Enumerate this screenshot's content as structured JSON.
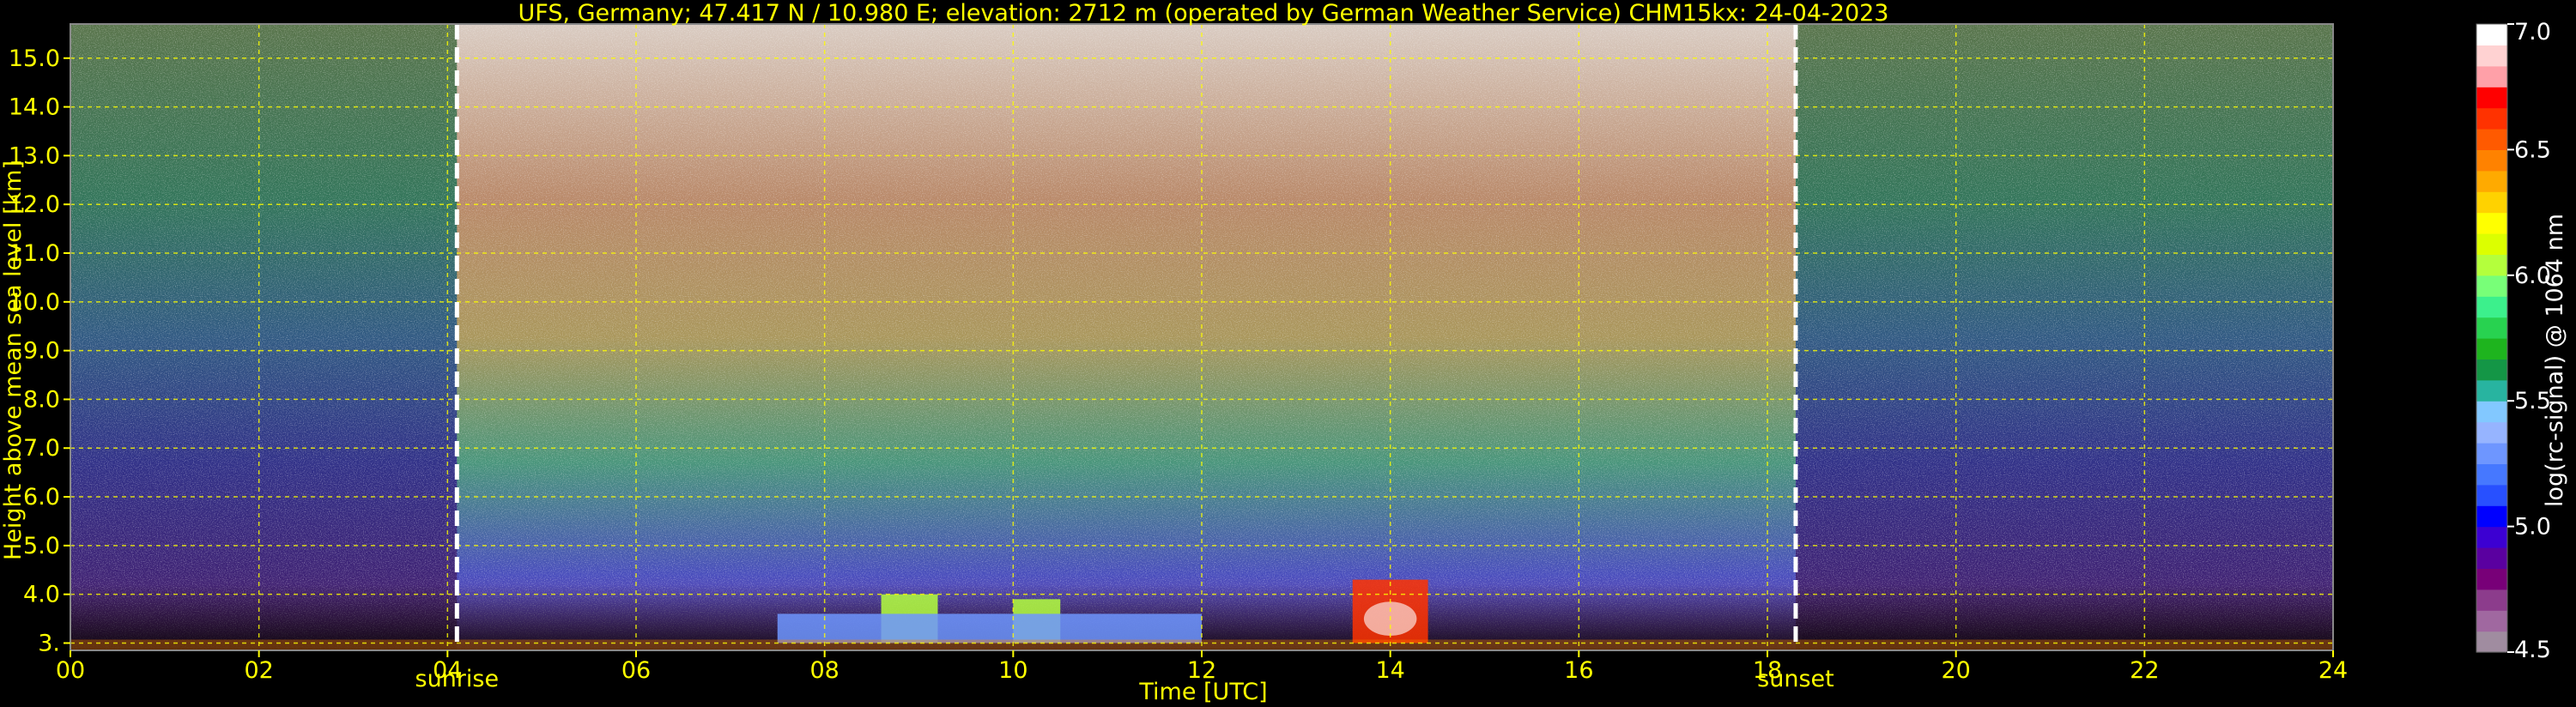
{
  "chart_data": {
    "type": "heatmap",
    "title": "UFS, Germany; 47.417 N / 10.980 E; elevation: 2712 m  (operated by German Weather Service)    CHM15kx: 24-04-2023",
    "xlabel": "Time [UTC]",
    "ylabel": "Height above mean sea level [km]",
    "colorbar_label": "log(rc-signal) @ 1064 nm",
    "xlim": [
      0,
      24
    ],
    "ylim": [
      2.85,
      15.7
    ],
    "x_ticks": [
      {
        "value": 0,
        "label": "00"
      },
      {
        "value": 2,
        "label": "02"
      },
      {
        "value": 4,
        "label": "04"
      },
      {
        "value": 6,
        "label": "06"
      },
      {
        "value": 8,
        "label": "08"
      },
      {
        "value": 10,
        "label": "10"
      },
      {
        "value": 12,
        "label": "12"
      },
      {
        "value": 14,
        "label": "14"
      },
      {
        "value": 16,
        "label": "16"
      },
      {
        "value": 18,
        "label": "18"
      },
      {
        "value": 20,
        "label": "20"
      },
      {
        "value": 22,
        "label": "22"
      },
      {
        "value": 24,
        "label": "24"
      }
    ],
    "y_ticks": [
      {
        "value": 3.0,
        "label": "3."
      },
      {
        "value": 4.0,
        "label": "4.0"
      },
      {
        "value": 5.0,
        "label": "5.0"
      },
      {
        "value": 6.0,
        "label": "6.0"
      },
      {
        "value": 7.0,
        "label": "7.0"
      },
      {
        "value": 8.0,
        "label": "8.0"
      },
      {
        "value": 9.0,
        "label": "9.0"
      },
      {
        "value": 10.0,
        "label": "10.0"
      },
      {
        "value": 11.0,
        "label": "11.0"
      },
      {
        "value": 12.0,
        "label": "12.0"
      },
      {
        "value": 13.0,
        "label": "13.0"
      },
      {
        "value": 14.0,
        "label": "14.0"
      },
      {
        "value": 15.0,
        "label": "15.0"
      }
    ],
    "grid": true,
    "markers": [
      {
        "x": 4.1,
        "label": "sunrise"
      },
      {
        "x": 18.3,
        "label": "sunset"
      }
    ],
    "colorbar": {
      "range": [
        4.5,
        7.0
      ],
      "ticks": [
        {
          "value": 4.5,
          "label": "4.5"
        },
        {
          "value": 5.0,
          "label": "5.0"
        },
        {
          "value": 5.5,
          "label": "5.5"
        },
        {
          "value": 6.0,
          "label": "6.0"
        },
        {
          "value": 6.5,
          "label": "6.5"
        },
        {
          "value": 7.0,
          "label": "7.0"
        }
      ],
      "colors": [
        "#a08ca0",
        "#a068a0",
        "#8c3c8c",
        "#780078",
        "#5a00a0",
        "#3c00d2",
        "#0000ff",
        "#2850ff",
        "#4678ff",
        "#6e96ff",
        "#96b4ff",
        "#82c8ff",
        "#28b4a0",
        "#149646",
        "#1eb41e",
        "#28d250",
        "#3cf08c",
        "#78ff78",
        "#b4ff3c",
        "#dcff00",
        "#ffff00",
        "#ffd200",
        "#ffaa00",
        "#ff8200",
        "#ff5a00",
        "#ff3200",
        "#ff0000",
        "#ffa0a8",
        "#ffd2d2",
        "#ffffff"
      ]
    },
    "features": [
      {
        "x_start": 13.6,
        "x_end": 14.4,
        "y_start": 3.0,
        "y_end": 4.3,
        "value": 6.6
      },
      {
        "x_start": 8.6,
        "x_end": 9.2,
        "y_start": 3.0,
        "y_end": 4.0,
        "value": 6.0
      },
      {
        "x_start": 10.0,
        "x_end": 10.5,
        "y_start": 3.0,
        "y_end": 3.9,
        "value": 6.0
      },
      {
        "x_start": 7.5,
        "x_end": 12.0,
        "y_start": 3.0,
        "y_end": 3.6,
        "value": 5.3
      }
    ]
  }
}
